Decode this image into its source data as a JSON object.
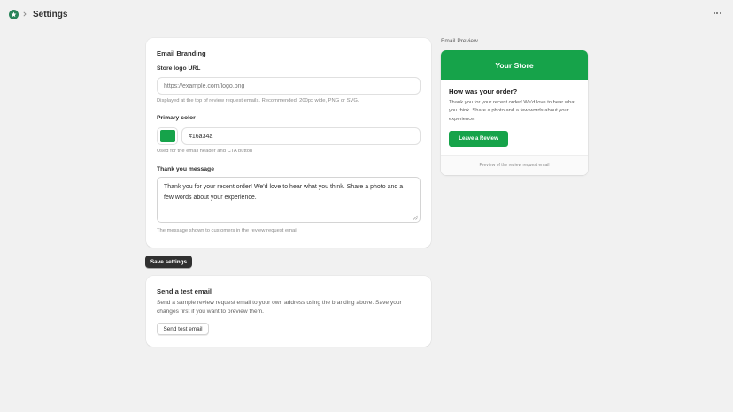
{
  "header": {
    "title": "Settings",
    "app_icon": "star-icon",
    "more_icon": "ellipsis-icon"
  },
  "branding": {
    "heading": "Email Branding",
    "logo": {
      "label": "Store logo URL",
      "value": "",
      "placeholder": "https://example.com/logo.png",
      "help": "Displayed at the top of review request emails. Recommended: 200px wide, PNG or SVG."
    },
    "color": {
      "label": "Primary color",
      "value": "#16a34a",
      "swatch": "#16a34a",
      "help": "Used for the email header and CTA button"
    },
    "message": {
      "label": "Thank you message",
      "value": "Thank you for your recent order! We'd love to hear what you think. Share a photo and a few words about your experience.",
      "help": "The message shown to customers in the review request email"
    }
  },
  "save_label": "Save settings",
  "test_email": {
    "heading": "Send a test email",
    "description": "Send a sample review request email to your own address using the branding above. Save your changes first if you want to preview them.",
    "button": "Send test email"
  },
  "preview": {
    "title": "Email Preview",
    "store_name": "Your Store",
    "heading": "How was your order?",
    "body": "Thank you for your recent order! We'd love to hear what you think. Share a photo and a few words about your experience.",
    "cta": "Leave a Review",
    "footer": "Preview of the review request email"
  },
  "colors": {
    "accent": "#16a34a",
    "app_icon": "#29845a",
    "primary_button": "#303030"
  }
}
